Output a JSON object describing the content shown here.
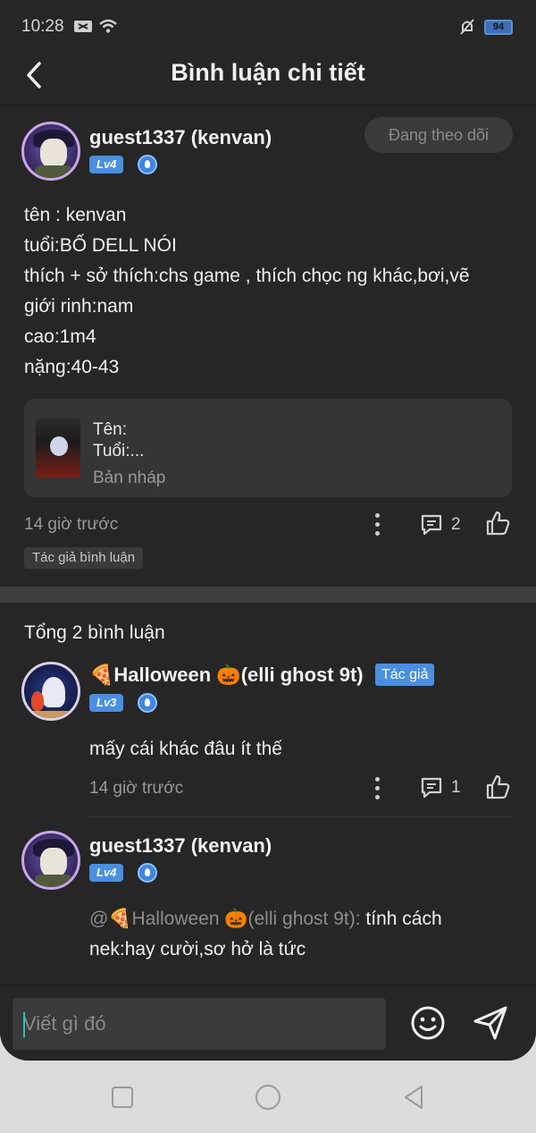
{
  "status_bar": {
    "time": "10:28",
    "battery": "94"
  },
  "header": {
    "title": "Bình luận chi tiết"
  },
  "post": {
    "username": "guest1337 (kenvan)",
    "level": "Lv4",
    "follow_label": "Đang theo dõi",
    "lines": [
      "tên : kenvan",
      "tuổi:BỐ DELL NÓI",
      "thích + sở thích:chs game , thích chọc ng khác,bơi,vẽ",
      "giới rinh:nam",
      "cao:1m4",
      "nặng:40-43"
    ],
    "draft": {
      "line1": "Tên:",
      "line2": "Tuổi:...",
      "subtitle": "Bản nháp"
    },
    "time": "14 giờ trước",
    "reply_count": "2",
    "author_chip": "Tác giả bình luận"
  },
  "comments_header": {
    "total": "Tổng 2 bình luận"
  },
  "comments": [
    {
      "username": "🍕Halloween 🎃(elli ghost 9t)",
      "level": "Lv3",
      "tag": "Tác giả",
      "text": "mấy cái khác đâu ít thế",
      "time": "14 giờ trước",
      "reply_count": "1"
    },
    {
      "username": "guest1337 (kenvan)",
      "level": "Lv4",
      "mention": "@🍕Halloween 🎃(elli ghost 9t):",
      "text_part1": " tính cách",
      "text_part2": "nek:hay cười,sơ hở là tức"
    }
  ],
  "input": {
    "placeholder": "Viết gì đó"
  },
  "icons": {
    "back": "chevron-left-icon",
    "more": "more-vertical-icon",
    "reply": "comment-icon",
    "like": "thumbs-up-icon",
    "emoji": "smiley-icon",
    "send": "send-icon"
  },
  "colors": {
    "background": "#262626",
    "accent": "#4a8fe0",
    "cursor": "#2ec4a8"
  }
}
